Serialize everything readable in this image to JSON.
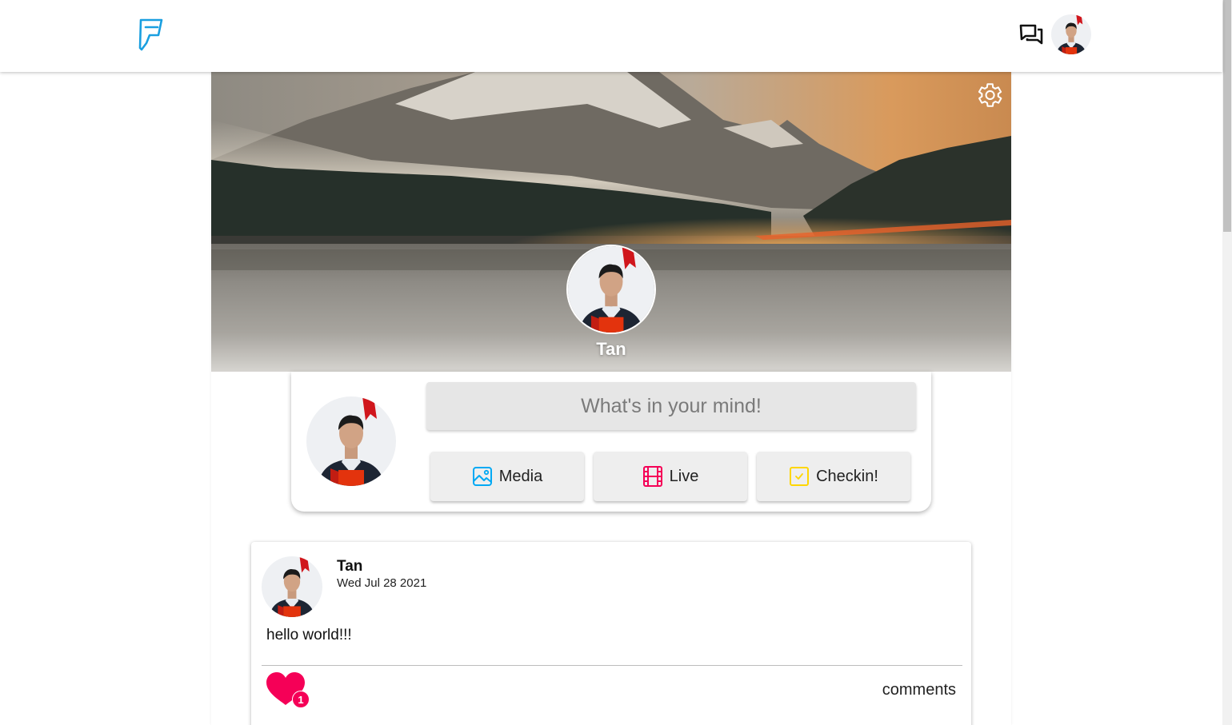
{
  "profile": {
    "name": "Tan"
  },
  "composer": {
    "placeholder": "What's in your mind!",
    "actions": [
      {
        "label": "Media",
        "icon": "image-icon",
        "color": "#03a9f4"
      },
      {
        "label": "Live",
        "icon": "film-icon",
        "color": "#f50057"
      },
      {
        "label": "Checkin!",
        "icon": "check-box-icon",
        "color": "#ffd600"
      }
    ]
  },
  "post": {
    "author": "Tan",
    "date": "Wed Jul 28 2021",
    "text": "hello world!!!",
    "like_count": "1",
    "comments_label": "comments"
  },
  "colors": {
    "brand": "#1a9fe0",
    "like": "#f50057"
  },
  "icons": {
    "logo": "foursquare-logo",
    "chat": "forum-icon",
    "settings": "gear-icon",
    "like": "heart-icon"
  }
}
